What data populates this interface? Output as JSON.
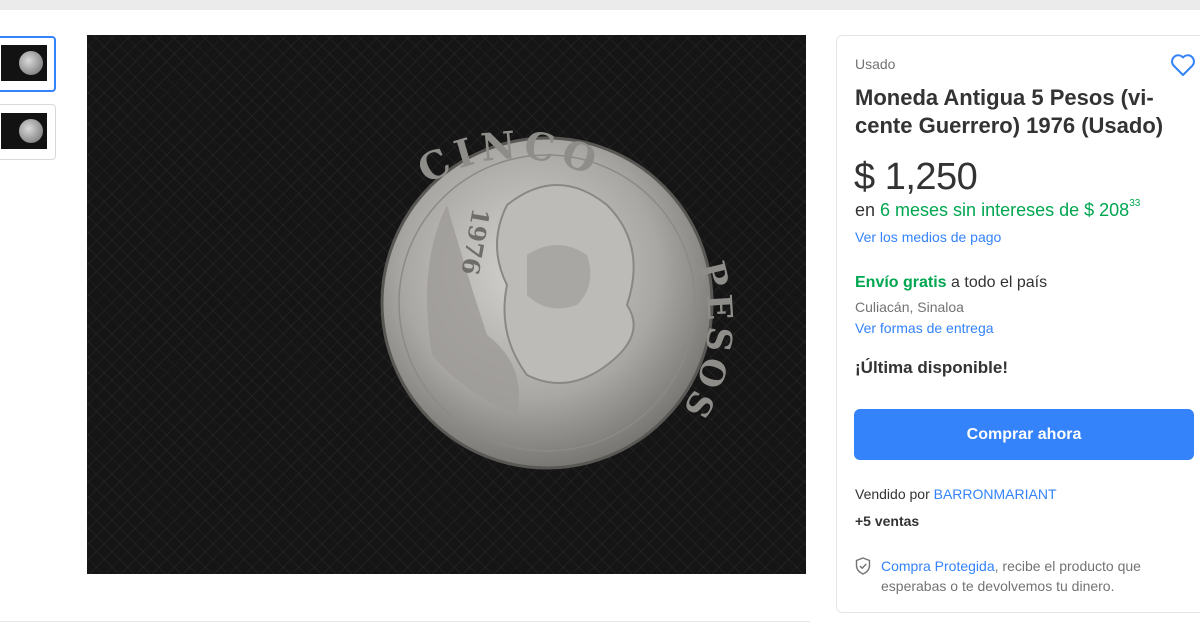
{
  "gallery": {
    "thumbnails": [
      {
        "alt": "coin-thumbnail-1",
        "active": true
      },
      {
        "alt": "coin-thumbnail-2",
        "active": false
      }
    ],
    "coin": {
      "top_text": "CINCO",
      "side_text": "PESOS",
      "year": "1976"
    }
  },
  "product": {
    "condition": "Usado",
    "title": "Moneda Antigua 5 Pesos (vi- cente Guerrero) 1976 (Usado)",
    "price": "$ 1,250",
    "installments_prefix": "en ",
    "installments_offer": "6 meses sin intereses de $ 208",
    "installments_cents": "33",
    "payment_link": "Ver los medios de pago",
    "shipping_free": "Envío gratis",
    "shipping_rest": " a todo el país",
    "location": "Culiacán, Sinaloa",
    "delivery_link": "Ver formas de entrega",
    "stock": "¡Última disponible!",
    "buy_label": "Comprar ahora",
    "seller_prefix": "Vendido por ",
    "seller_name": "BARRONMARIANT",
    "sales": "+5 ventas",
    "protect_link": "Compra Protegida",
    "protect_text": ", recibe el producto que esperabas o te devolvemos tu dinero."
  },
  "colors": {
    "accent": "#3483fa",
    "green": "#00a650",
    "muted": "#737373"
  },
  "icons": [
    "heart-icon",
    "shield-check-icon"
  ]
}
